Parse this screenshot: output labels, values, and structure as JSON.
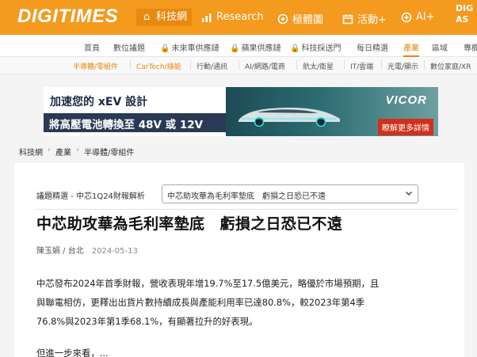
{
  "header": {
    "logo": "DIGITIMES",
    "nav": [
      {
        "label": "科技網",
        "icon": "home-icon"
      },
      {
        "label": "Research",
        "icon": "chart-icon"
      },
      {
        "label": "極體圖",
        "icon": "chip-icon"
      },
      {
        "label": "活動+",
        "icon": "calendar-icon"
      },
      {
        "label": "AI+",
        "icon": "ai-icon"
      }
    ],
    "right_text": "DIG AS"
  },
  "secondary_nav": [
    "首頁",
    "數位議題",
    "未來車供應鏈",
    "蘋果供應鏈",
    "科技採送門",
    "每日精選",
    "產業",
    "區域",
    "專欄"
  ],
  "tertiary_nav": [
    "半導體/零組件",
    "CarTech/綠能",
    "行動/通訊",
    "AI/網路/電商",
    "航太/衛星",
    "IT/雲端",
    "光電/顯示",
    "數位家庭/XR"
  ],
  "ad": {
    "line1": "加速您的 xEV 設計",
    "line2": "將高壓電池轉換至 48V 或 12V",
    "brand": "VICOR",
    "cta": "瞭解更多詳情"
  },
  "breadcrumb": [
    "科技網",
    "產業",
    "半導體/零組件"
  ],
  "article": {
    "topic_label": "議題精選 - 中芯1Q24財報解析",
    "topic_selected": "中芯助攻華為毛利率墊底　虧損之日恐已不遠",
    "headline": "中芯助攻華為毛利率墊底　虧損之日恐已不遠",
    "author": "陳玉娟 / 台北",
    "date": "2024-05-13",
    "body_lines": [
      "中芯發布2024年首季財報，營收表現年增19.7%至17.5億美元，略優於市場預期，且",
      "與聯電相仿，更釋出出貨片數持續成長與產能利用率已達80.8%，較2023年第4季",
      "76.8%與2023年第1季68.1%，有顯著拉升的好表現。"
    ],
    "body_tail": "但進一步來看，..."
  }
}
